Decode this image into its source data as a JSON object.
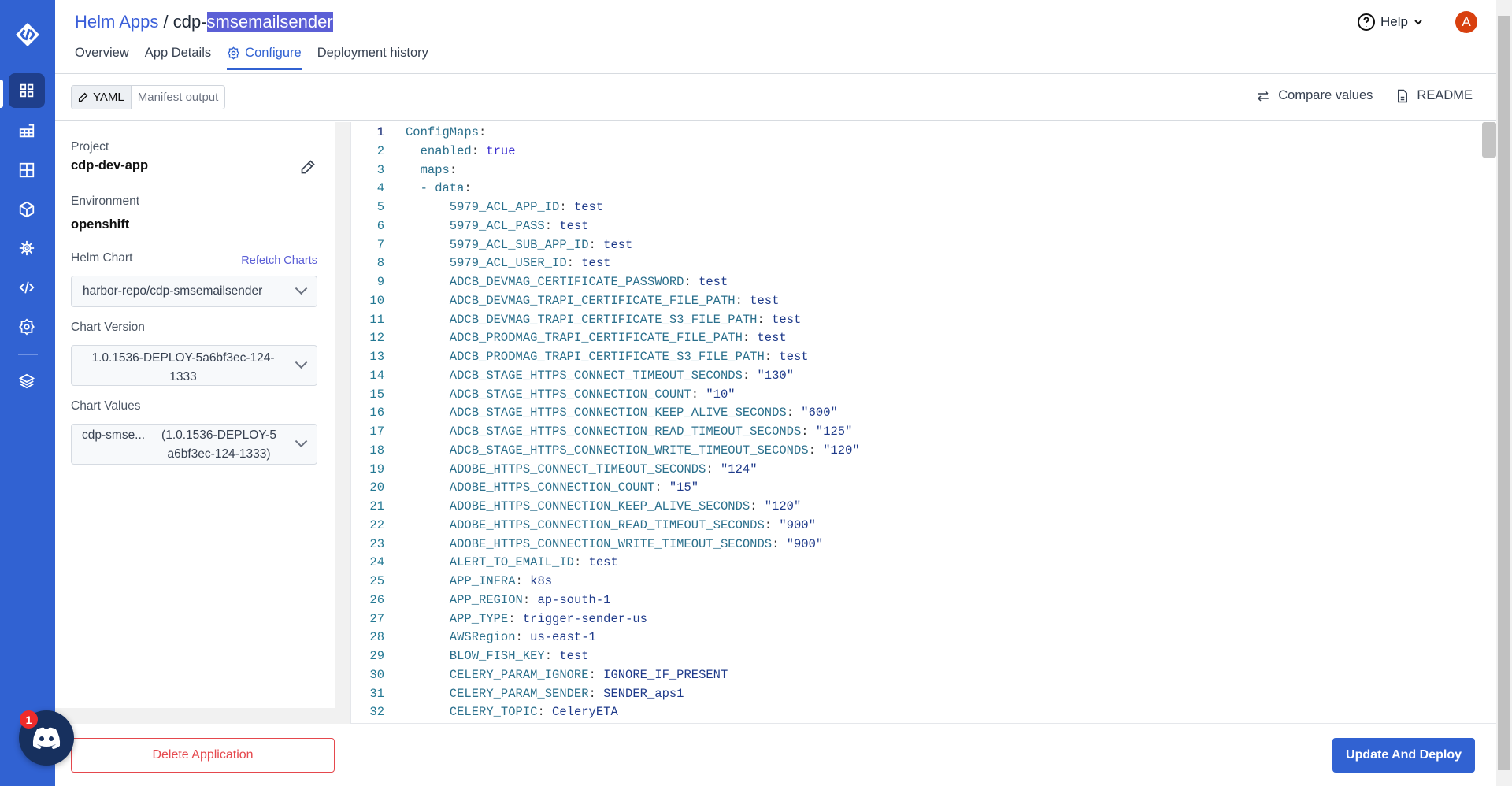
{
  "header": {
    "breadcrumb_root": "Helm Apps",
    "separator": " / ",
    "app_prefix": "cdp-",
    "app_selected": "smsemailsender",
    "help": "Help",
    "avatar_initial": "A"
  },
  "tabs": [
    {
      "label": "Overview"
    },
    {
      "label": "App Details"
    },
    {
      "label": "Configure"
    },
    {
      "label": "Deployment history"
    }
  ],
  "toolbar": {
    "yaml": "YAML",
    "manifest": "Manifest output",
    "compare": "Compare values",
    "readme": "README"
  },
  "left": {
    "project_label": "Project",
    "project": "cdp-dev-app",
    "env_label": "Environment",
    "env": "openshift",
    "chart_label": "Helm Chart",
    "refetch": "Refetch Charts",
    "chart": "harbor-repo/cdp-smsemailsender",
    "version_label": "Chart Version",
    "version": "1.0.1536-DEPLOY-5a6bf3ec-124-1333",
    "values_label": "Chart Values",
    "values_name": "cdp-smse...",
    "values_version": "(1.0.1536-DEPLOY-5a6bf3ec-124-1333)"
  },
  "footer": {
    "delete": "Delete Application",
    "deploy": "Update And Deploy"
  },
  "discord": {
    "badge": "1"
  },
  "colors": {
    "accent": "#3162d2",
    "danger": "#e5484d",
    "avatar": "#d8400f"
  },
  "editor": {
    "lines": [
      {
        "k": "ConfigMaps",
        "v": ""
      },
      {
        "k": "  enabled",
        "v": "true",
        "t": "bool"
      },
      {
        "k": "  maps",
        "v": ""
      },
      {
        "k": "  - data",
        "v": ""
      },
      {
        "k": "      5979_ACL_APP_ID",
        "v": "test"
      },
      {
        "k": "      5979_ACL_PASS",
        "v": "test"
      },
      {
        "k": "      5979_ACL_SUB_APP_ID",
        "v": "test"
      },
      {
        "k": "      5979_ACL_USER_ID",
        "v": "test"
      },
      {
        "k": "      ADCB_DEVMAG_CERTIFICATE_PASSWORD",
        "v": "test"
      },
      {
        "k": "      ADCB_DEVMAG_TRAPI_CERTIFICATE_FILE_PATH",
        "v": "test"
      },
      {
        "k": "      ADCB_DEVMAG_TRAPI_CERTIFICATE_S3_FILE_PATH",
        "v": "test"
      },
      {
        "k": "      ADCB_PRODMAG_TRAPI_CERTIFICATE_FILE_PATH",
        "v": "test"
      },
      {
        "k": "      ADCB_PRODMAG_TRAPI_CERTIFICATE_S3_FILE_PATH",
        "v": "test"
      },
      {
        "k": "      ADCB_STAGE_HTTPS_CONNECT_TIMEOUT_SECONDS",
        "v": "\"130\""
      },
      {
        "k": "      ADCB_STAGE_HTTPS_CONNECTION_COUNT",
        "v": "\"10\""
      },
      {
        "k": "      ADCB_STAGE_HTTPS_CONNECTION_KEEP_ALIVE_SECONDS",
        "v": "\"600\""
      },
      {
        "k": "      ADCB_STAGE_HTTPS_CONNECTION_READ_TIMEOUT_SECONDS",
        "v": "\"125\""
      },
      {
        "k": "      ADCB_STAGE_HTTPS_CONNECTION_WRITE_TIMEOUT_SECONDS",
        "v": "\"120\""
      },
      {
        "k": "      ADOBE_HTTPS_CONNECT_TIMEOUT_SECONDS",
        "v": "\"124\""
      },
      {
        "k": "      ADOBE_HTTPS_CONNECTION_COUNT",
        "v": "\"15\""
      },
      {
        "k": "      ADOBE_HTTPS_CONNECTION_KEEP_ALIVE_SECONDS",
        "v": "\"120\""
      },
      {
        "k": "      ADOBE_HTTPS_CONNECTION_READ_TIMEOUT_SECONDS",
        "v": "\"900\""
      },
      {
        "k": "      ADOBE_HTTPS_CONNECTION_WRITE_TIMEOUT_SECONDS",
        "v": "\"900\""
      },
      {
        "k": "      ALERT_TO_EMAIL_ID",
        "v": "test"
      },
      {
        "k": "      APP_INFRA",
        "v": "k8s"
      },
      {
        "k": "      APP_REGION",
        "v": "ap-south-1"
      },
      {
        "k": "      APP_TYPE",
        "v": "trigger-sender-us"
      },
      {
        "k": "      AWSRegion",
        "v": "us-east-1"
      },
      {
        "k": "      BLOW_FISH_KEY",
        "v": "test"
      },
      {
        "k": "      CELERY_PARAM_IGNORE",
        "v": "IGNORE_IF_PRESENT"
      },
      {
        "k": "      CELERY_PARAM_SENDER",
        "v": "SENDER_aps1"
      },
      {
        "k": "      CELERY_TOPIC",
        "v": "CeleryETA"
      }
    ]
  }
}
